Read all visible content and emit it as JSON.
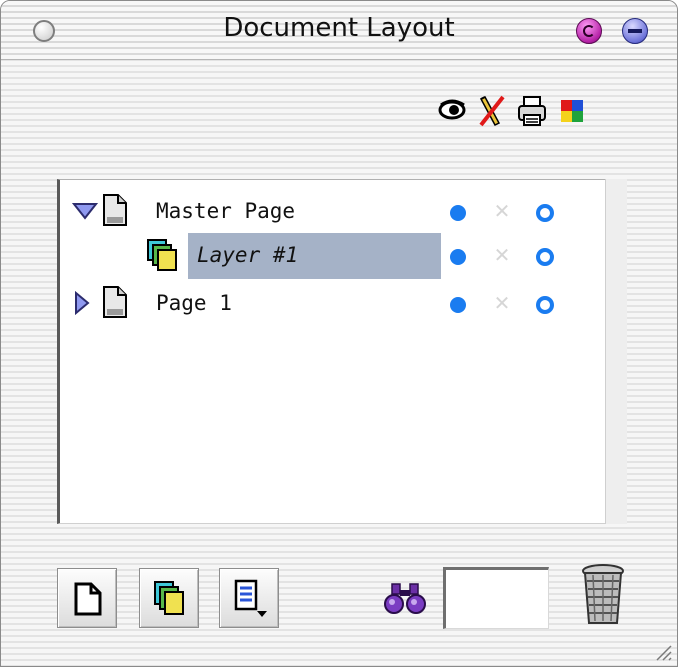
{
  "window": {
    "title": "Document Layout"
  },
  "header_icons": [
    "eye-icon",
    "no-edit-pencil-icon",
    "printer-icon",
    "color-swatch-icon"
  ],
  "tree": {
    "rows": [
      {
        "label": "Master Page",
        "expanded": true,
        "icon": "page-icon",
        "visible": true,
        "locked": false,
        "printable": true
      },
      {
        "label": "Layer #1",
        "icon": "layers-icon",
        "selected": true,
        "visible": true,
        "locked": false,
        "printable": true
      },
      {
        "label": "Page 1",
        "expanded": false,
        "icon": "page-icon",
        "visible": true,
        "locked": false,
        "printable": true
      }
    ]
  },
  "toolbar": {
    "new_page_icon": "new-page-icon",
    "new_layer_icon": "new-layer-icon",
    "options_icon": "options-menu-icon",
    "find_icon": "binoculars-icon",
    "search_value": "",
    "trash_icon": "trash-icon"
  },
  "colors": {
    "selection": "#a5b2c7",
    "accent": "#1a7cf0"
  }
}
